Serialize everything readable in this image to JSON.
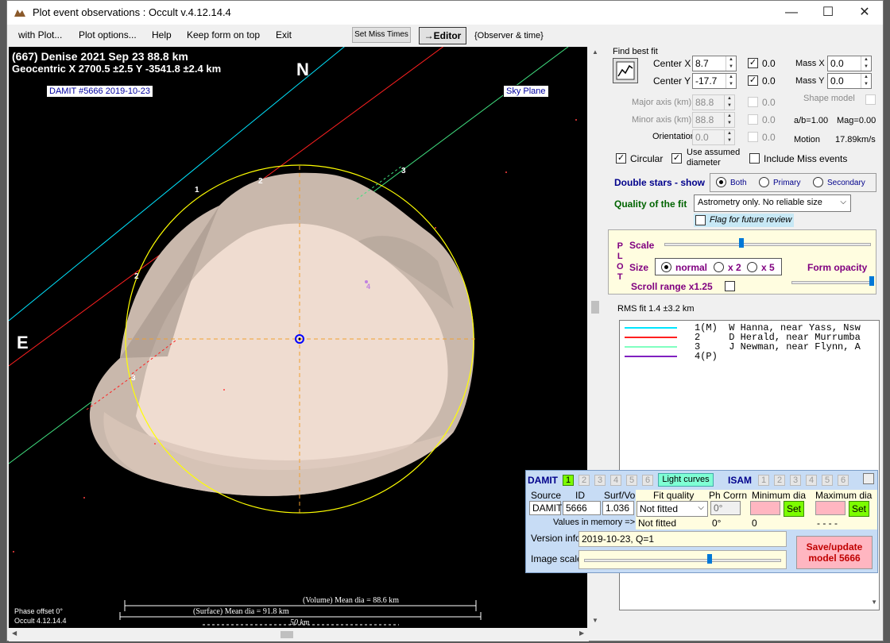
{
  "window": {
    "title": "Plot event observations : Occult v.4.12.14.4",
    "controls": [
      "—",
      "☐",
      "✕"
    ]
  },
  "menu": {
    "items": [
      "with Plot...",
      "Plot options...",
      "Help",
      "Keep form on top",
      "Exit"
    ],
    "set_miss_times": "Set Miss Times",
    "editor": "→Editor",
    "observer_time": "{Observer & time}"
  },
  "plot": {
    "header_line1": "(667) Denise  2021 Sep 23   88.8 km",
    "header_line2": "Geocentric  X  2700.5 ±2.5  Y -3541.8 ±2.4 km",
    "north": "N",
    "east": "E",
    "damit_label": "DAMIT #5666 2019-10-23",
    "sky_plane": "Sky Plane",
    "chord_labels": [
      "1",
      "2",
      "2",
      "3",
      "3",
      "4"
    ],
    "phase_offset": "Phase offset 0°",
    "occult_version": "Occult 4.12.14.4",
    "volume_dia": "(Volume) Mean dia = 88.6 km",
    "surface_dia": "(Surface) Mean dia = 91.8 km",
    "scale_bar": "50 km",
    "colors": {
      "background": "#000000",
      "shape": "#e8d8cc",
      "fit_ellipse": "#ffff00",
      "chord1": "#00e5ff",
      "chord2": "#ff2020",
      "chord3": "#40e080",
      "chord4": "#a040c0"
    }
  },
  "find_best_fit": {
    "title": "Find best fit",
    "center_x_label": "Center X",
    "center_x": "8.7",
    "center_x_chk": "0.0",
    "center_y_label": "Center Y",
    "center_y": "-17.7",
    "center_y_chk": "0.0",
    "mass_x_label": "Mass X",
    "mass_x": "0.0",
    "mass_y_label": "Mass Y",
    "mass_y": "0.0",
    "major_label": "Major axis (km)",
    "major": "88.8",
    "major_chk": "0.0",
    "minor_label": "Minor axis (km)",
    "minor": "88.8",
    "minor_chk": "0.0",
    "orient_label": "Orientation",
    "orient": "0.0",
    "orient_chk": "0.0",
    "shape_model": "Shape model",
    "ab": "a/b=1.00",
    "mag": "Mag=0.00",
    "motion_label": "Motion",
    "motion": "17.89km/s",
    "circular": "Circular",
    "use_assumed_1": "Use assumed",
    "use_assumed_2": "diameter",
    "include_miss": "Include Miss events"
  },
  "double_stars": {
    "label": "Double stars - show",
    "options": [
      "Both",
      "Primary",
      "Secondary"
    ]
  },
  "quality": {
    "label": "Quality of the fit",
    "value": "Astrometry only. No reliable size",
    "flag": "Flag for future review"
  },
  "plot_panel": {
    "side_label": [
      "P",
      "L",
      "O",
      "T"
    ],
    "scale": "Scale",
    "size": "Size",
    "size_options": [
      "normal",
      "x 2",
      "x 5"
    ],
    "form_opacity": "Form opacity",
    "scroll_range": "Scroll range x1.25",
    "scale_level": 0.37,
    "opacity_level": 1.0
  },
  "rms": "RMS fit  1.4 ±3.2 km",
  "legend": [
    {
      "text": "1(M)  W Hanna, near Yass, Nsw",
      "color": "#00e5ff"
    },
    {
      "text": "2     D Herald, near Murrumba",
      "color": "#ff2020"
    },
    {
      "text": "3     J Newman, near Flynn, A",
      "color": "#80ffc0"
    },
    {
      "text": "4(P)",
      "color": "#8020c0"
    }
  ],
  "damit_panel": {
    "damit": "DAMIT",
    "damit_tabs": [
      "1",
      "2",
      "3",
      "4",
      "5",
      "6"
    ],
    "light_curves": "Light curves",
    "isam": "ISAM",
    "isam_tabs": [
      "1",
      "2",
      "3",
      "4",
      "5",
      "6"
    ],
    "source_label": "Source",
    "id_label": "ID",
    "surf_vol_label": "Surf/Vol",
    "source": "DAMIT",
    "id": "5666",
    "surf_vol": "1.036",
    "values_in_memory": "Values in memory =>",
    "fit_quality_label": "Fit quality",
    "fit_quality": "Not fitted",
    "fit_quality_mem": "Not fitted",
    "ph_corr_label": "Ph Corrn",
    "ph_corr": "0°",
    "ph_corr_mem": "0°",
    "min_dia_label": "Minimum dia",
    "min_dia_mem": "0",
    "max_dia_label": "Maximum dia",
    "max_dia_mem": "- - - -",
    "set": "Set",
    "version_label": "Version info",
    "version": "2019-10-23, Q=1",
    "image_scale": "Image scale",
    "save_update": "Save/update",
    "model": "model 5666",
    "image_scale_level": 0.64
  }
}
